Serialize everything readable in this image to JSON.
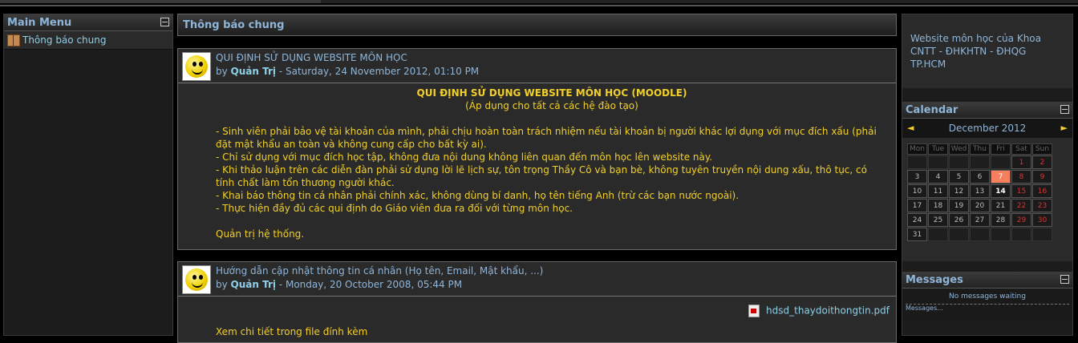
{
  "left": {
    "menu_title": "Main Menu",
    "items": [
      {
        "label": "Thông báo chung",
        "icon": "forum-icon"
      }
    ]
  },
  "center": {
    "title": "Thông báo chung",
    "posts": [
      {
        "subject": "QUI ĐỊNH SỬ DỤNG WEBSITE MÔN HỌC",
        "by": "by",
        "author": "Quản Trị",
        "date": " - Saturday, 24 November 2012, 01:10 PM",
        "heading": "QUI ĐỊNH SỬ DỤNG WEBSITE MÔN HỌC (MOODLE)",
        "subheading": "(Áp dụng cho tất cả các hệ đào tạo)",
        "lines": [
          "- Sinh viên phải bảo vệ tài khoản của mình, phải chịu hoàn toàn trách nhiệm nếu tài khoản bị người khác lợi dụng với mục đích xấu (phải đặt mật khẩu an toàn và không cung cấp cho bất kỳ ai).",
          "- Chỉ sử dụng với mục đích học tập, không đưa nội dung không liên quan đến môn học lên website này.",
          "- Khi thảo luận trên các diễn đàn phải sử dụng lời lẽ lịch sự, tôn trọng Thầy Cô và bạn bè, không tuyên truyền nội dung xấu, thô tục, có tính chất làm tổn thương người khác.",
          "- Khai báo thông tin cá nhân phải chính xác, không dùng bí danh, họ tên tiếng Anh (trừ các bạn nước ngoài).",
          "- Thực hiện đầy đủ các qui định do Giáo viên đưa ra đối với từng môn học."
        ],
        "signature": "Quản trị hệ thống."
      },
      {
        "subject": "Hướng dẫn cập nhật thông tin cá nhân (Họ tên, Email, Mật khẩu, ...)",
        "by": "by",
        "author": "Quản Trị",
        "date": " - Monday, 20 October 2008, 05:44 PM",
        "attachment": "hdsd_thaydoithongtin.pdf",
        "body": "Xem chi tiết trong file đính kèm"
      }
    ]
  },
  "right": {
    "site_info": "Website môn học của Khoa CNTT - ĐHKHTN - ĐHQG TP.HCM",
    "calendar": {
      "title": "Calendar",
      "month": "December 2012",
      "prev": "◄",
      "next": "►",
      "weekdays": [
        "Mon",
        "Tue",
        "Wed",
        "Thu",
        "Fri",
        "Sat",
        "Sun"
      ],
      "weeks": [
        [
          "",
          "",
          "",
          "",
          "",
          "1",
          "2"
        ],
        [
          "3",
          "4",
          "5",
          "6",
          "7",
          "8",
          "9"
        ],
        [
          "10",
          "11",
          "12",
          "13",
          "14",
          "15",
          "16"
        ],
        [
          "17",
          "18",
          "19",
          "20",
          "21",
          "22",
          "23"
        ],
        [
          "24",
          "25",
          "26",
          "27",
          "28",
          "29",
          "30"
        ],
        [
          "31",
          "",
          "",
          "",
          "",
          "",
          ""
        ]
      ],
      "today": "7",
      "current": "14"
    },
    "messages": {
      "title": "Messages",
      "none": "No messages waiting",
      "link": "Messages..."
    }
  }
}
